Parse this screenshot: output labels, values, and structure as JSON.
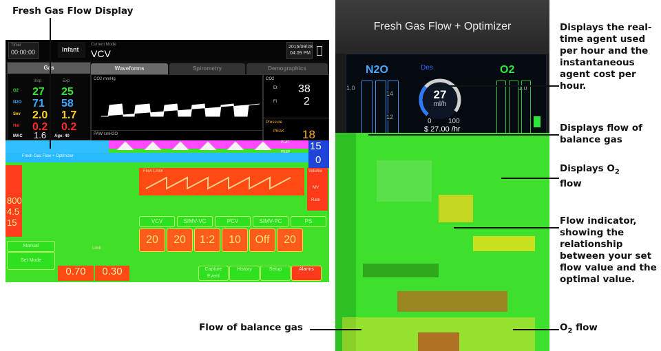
{
  "callouts": {
    "fresh_gas_flow_display": "Fresh Gas Flow Display",
    "agent_cost": "Displays the real-time agent used per hour and the instantaneous agent cost per hour.",
    "balance_gas_flow": "Displays flow of balance gas",
    "o2_flow_prefix": "Displays O",
    "o2_flow_sub": "2",
    "o2_flow_suffix": "flow",
    "flow_indicator": "Flow indicator, showing the relationship between your set flow value and the optimal value.",
    "flow_of_balance_gas": "Flow of balance gas",
    "o2_flow_label_prefix": "O",
    "o2_flow_label_sub": "2",
    "o2_flow_label_suffix": " flow"
  },
  "left_screen": {
    "timer_label": "Timer",
    "timer": "00:00:00",
    "patient": "Infant",
    "mode_label": "Current Mode",
    "mode": "VCV",
    "date": "2016/09/28",
    "time": "04:09 PM",
    "gas_tab": "Gas",
    "insp": "Insp",
    "exp": "Exp",
    "tabs": [
      "Waveforms",
      "Spirometry",
      "Demographics"
    ],
    "gas_rows": [
      {
        "name": "O2",
        "insp": "27",
        "exp": "25",
        "color": "#35e835"
      },
      {
        "name": "N2O",
        "insp": "71",
        "exp": "58",
        "color": "#3ea8ff"
      },
      {
        "name": "Sev",
        "insp": "2.0",
        "exp": "1.7",
        "color": "#ffd21e"
      },
      {
        "name": "Hal",
        "insp": "0.2",
        "exp": "0.2",
        "color": "#ff2a2a"
      }
    ],
    "mac_label": "MAC",
    "mac": "1.6",
    "age": "Age: 40",
    "co2_wave_label": "CO2 mmHg",
    "co2_label": "CO2",
    "et_label": "Et",
    "fi_label": "Fi",
    "et": "38",
    "fi": "2",
    "paw_label": "PAW cmH2O",
    "pressure_label": "Pressure",
    "peak_label": "PEAK",
    "peak": "18",
    "plat_label": "PLAT",
    "plat": "15",
    "peep_label": "PEEP",
    "peep": "0",
    "optimizer_bar": "Fresh Gas Flow + Optimizer",
    "flow_label": "Flow L/min",
    "volume_label": "Volume",
    "mv_label": "MV",
    "rate_label": "Rate",
    "left_numbers": [
      "800",
      "4.5",
      "15"
    ],
    "mode_buttons": [
      "VCV",
      "SIMV-VC",
      "PCV",
      "SIMV-PC",
      "PS"
    ],
    "setting_buttons": [
      "20",
      "20",
      "1:2",
      "10",
      "Off",
      "20"
    ],
    "limit_label": "Limit",
    "left_buttons": [
      "Manual",
      "Set Mode"
    ],
    "flow_values": [
      "0.70",
      "0.30"
    ],
    "bottom_buttons": [
      "Capture Event",
      "History",
      "Setup",
      "Alarms"
    ]
  },
  "right_screen": {
    "title": "Fresh Gas Flow + Optimizer",
    "n2o": "N2O",
    "des": "Des",
    "o2": "O2",
    "scale_left": "1.0",
    "scale_right": "1.0",
    "tick_14": "14",
    "tick_12": "12",
    "agent_rate": "27",
    "agent_unit": "ml/h",
    "gauge_min": "0",
    "gauge_max": "100",
    "cost": "$ 27.00 /hr"
  }
}
